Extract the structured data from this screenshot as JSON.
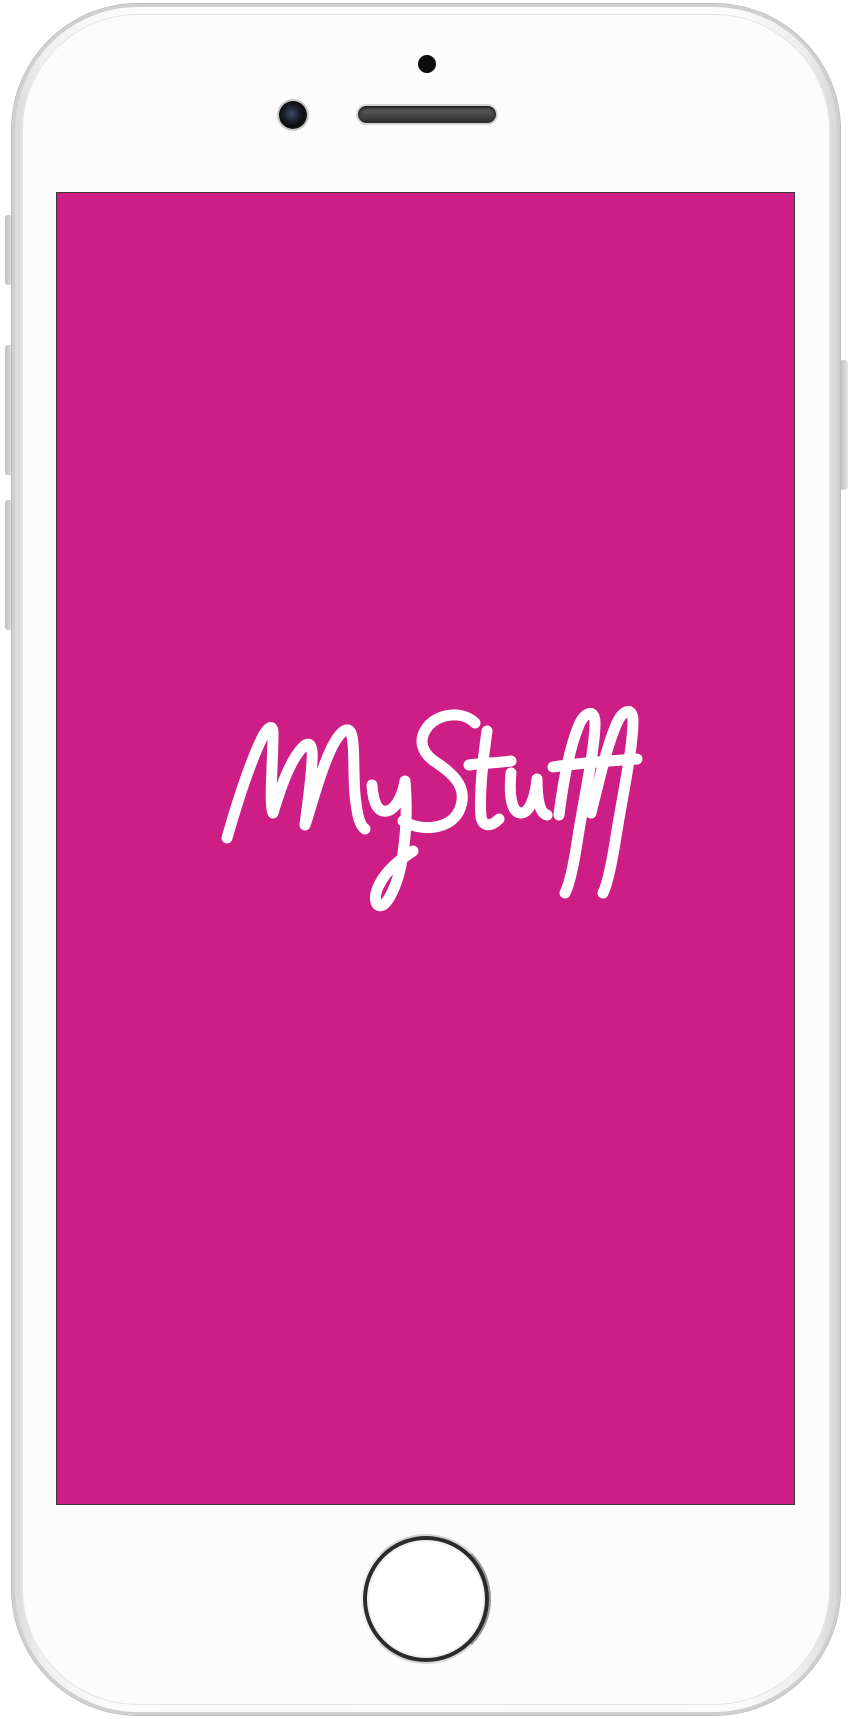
{
  "app": {
    "logo_text": "MyStuff",
    "logo_icon": "mystuff-script-logo"
  },
  "device": {
    "model": "smartphone-mockup",
    "home_button_icon": "home-button-ring-icon"
  },
  "colors": {
    "splash_background": "#CD1E86",
    "logo_color": "#FFFFFF",
    "device_body": "#FCFCFC",
    "device_edge": "#D0D0D0"
  }
}
